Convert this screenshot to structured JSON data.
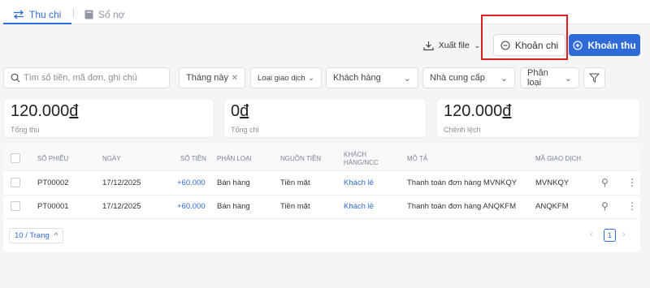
{
  "tabs": [
    {
      "label": "Thu chi",
      "icon": "swap-arrows-icon"
    },
    {
      "label": "Sổ nợ",
      "icon": "book-icon"
    }
  ],
  "toolbar": {
    "export_label": "Xuất file",
    "expense_label": "Khoản chi",
    "income_label": "Khoản thu"
  },
  "filters": {
    "search_placeholder": "Tìm số tiền, mã đơn, ghi chú",
    "month_chip": "Tháng này",
    "transaction_type": "Loại giao dịch",
    "customer": "Khách hàng",
    "supplier": "Nhà cung cấp",
    "category": "Phân loại"
  },
  "summary": [
    {
      "value": "120.000",
      "currency": "đ",
      "label": "Tổng thu"
    },
    {
      "value": "0",
      "currency": "đ",
      "label": "Tổng chi"
    },
    {
      "value": "120.000",
      "currency": "đ",
      "label": "Chênh lệch"
    }
  ],
  "table": {
    "headers": {
      "code": "SỐ PHIẾU",
      "date": "NGÀY",
      "amount": "SỐ TIỀN",
      "category": "PHÂN LOẠI",
      "source": "NGUỒN TIỀN",
      "partner_line1": "KHÁCH",
      "partner_line2": "HÀNG/NCC",
      "desc": "MÔ TẢ",
      "txn": "MÃ GIAO DỊCH"
    },
    "rows": [
      {
        "code": "PT00002",
        "date": "17/12/2025",
        "amount": "+60.000",
        "category": "Bán hàng",
        "source": "Tiền mặt",
        "partner": "Khách lẻ",
        "desc": "Thanh toán đơn hàng MVNKQY",
        "txn": "MVNKQY"
      },
      {
        "code": "PT00001",
        "date": "17/12/2025",
        "amount": "+60.000",
        "category": "Bán hàng",
        "source": "Tiền mặt",
        "partner": "Khách lẻ",
        "desc": "Thanh toán đơn hàng ANQKFM",
        "txn": "ANQKFM"
      }
    ]
  },
  "pagination": {
    "page_size": "10 / Trang",
    "current_page": "1"
  },
  "colors": {
    "accent": "#2f6bd8",
    "highlight_border": "#e02020"
  }
}
